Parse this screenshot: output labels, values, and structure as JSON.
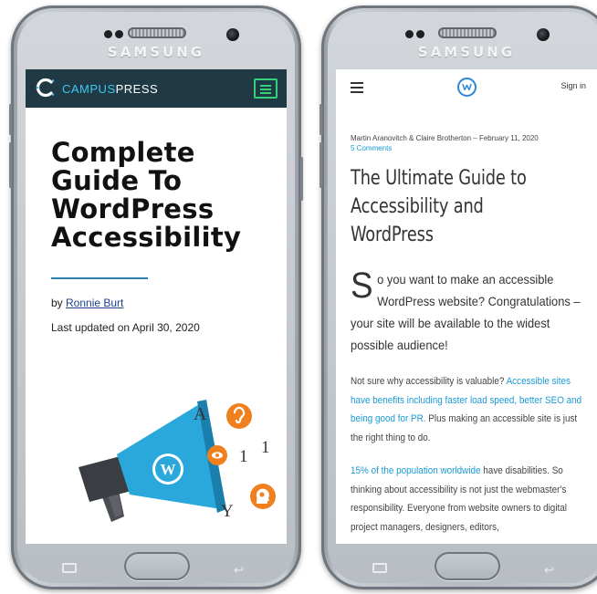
{
  "left_phone": {
    "brand": "SAMSUNG",
    "header": {
      "logo_letter": "C",
      "logo_campus": "CAMPUS",
      "logo_press": "PRESS"
    },
    "article": {
      "title_lines": [
        "Complete",
        "Guide To",
        "WordPress",
        "Accessibility"
      ],
      "by_prefix": "by ",
      "author": "Ronnie Burt",
      "updated": "Last updated on April 30, 2020"
    },
    "illustration": {
      "letters": [
        "A",
        "1",
        "1",
        "Y"
      ]
    }
  },
  "right_phone": {
    "brand": "SAMSUNG",
    "topbar": {
      "signin": "Sign in"
    },
    "article": {
      "meta": "Martin Aranovitch & Claire Brotherton  – February 11, 2020",
      "comments": "5 Comments",
      "title_lines": [
        "The Ultimate Guide to",
        "Accessibility and",
        "WordPress"
      ],
      "lead_dropcap": "S",
      "lead_text": "o you want to make an accessible WordPress website? Congratulations – your site will be available to the widest possible audience!",
      "p1_before": "Not sure why accessibility is valuable? ",
      "p1_link": "Accessible sites have benefits including faster load speed, better SEO and being good for PR.",
      "p1_after": " Plus making an accessible site is just the right thing to do.",
      "p2_link": "15% of the population worldwide",
      "p2_after": " have disabilities. So thinking about accessibility is not just the webmaster's responsibility. Everyone from website owners to digital project managers, designers, editors,"
    }
  },
  "colors": {
    "campuspress_header": "#1f3a45",
    "campus_accent": "#3ec6f2",
    "menu_green": "#34d07a",
    "link_blue": "#1a9ad6",
    "megaphone_blue": "#2aa8dc",
    "icon_orange": "#f0801e"
  }
}
